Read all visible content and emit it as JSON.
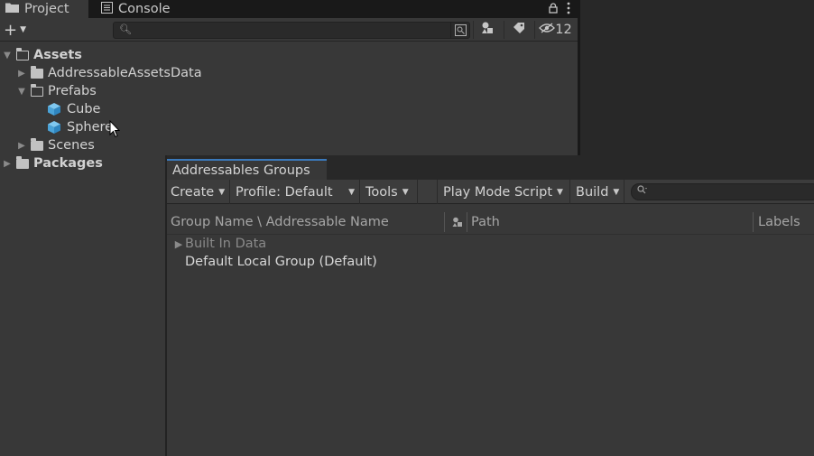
{
  "tabs": {
    "project": "Project",
    "console": "Console"
  },
  "project_toolbar": {
    "add_label": "+",
    "search_placeholder": "",
    "hidden_count": "12"
  },
  "tree": {
    "assets": "Assets",
    "addressable_assets_data": "AddressableAssetsData",
    "prefabs": "Prefabs",
    "cube": "Cube",
    "sphere": "Sphere",
    "scenes": "Scenes",
    "packages": "Packages"
  },
  "addressables": {
    "window_title": "Addressables Groups",
    "toolbar": {
      "create": "Create",
      "profile": "Profile: Default",
      "tools": "Tools",
      "play_mode": "Play Mode Script",
      "build": "Build",
      "search_placeholder": ""
    },
    "columns": {
      "name": "Group Name \\ Addressable Name",
      "path": "Path",
      "labels": "Labels"
    },
    "groups": {
      "built_in": "Built In Data",
      "default_local": "Default Local Group (Default)"
    }
  },
  "colors": {
    "panel_bg": "#383838",
    "dark_bg": "#282828",
    "tab_accent": "#3a79bb",
    "cube_icon": "#5ab3e6"
  },
  "icons": {
    "project_tab": "folder-icon",
    "console_tab": "console-icon",
    "lock": "lock-icon",
    "menu": "kebab-menu-icon",
    "search": "search-icon",
    "filter_type": "shapes-filter-icon",
    "filter_label": "label-tag-icon",
    "hidden": "eye-slash-icon"
  }
}
